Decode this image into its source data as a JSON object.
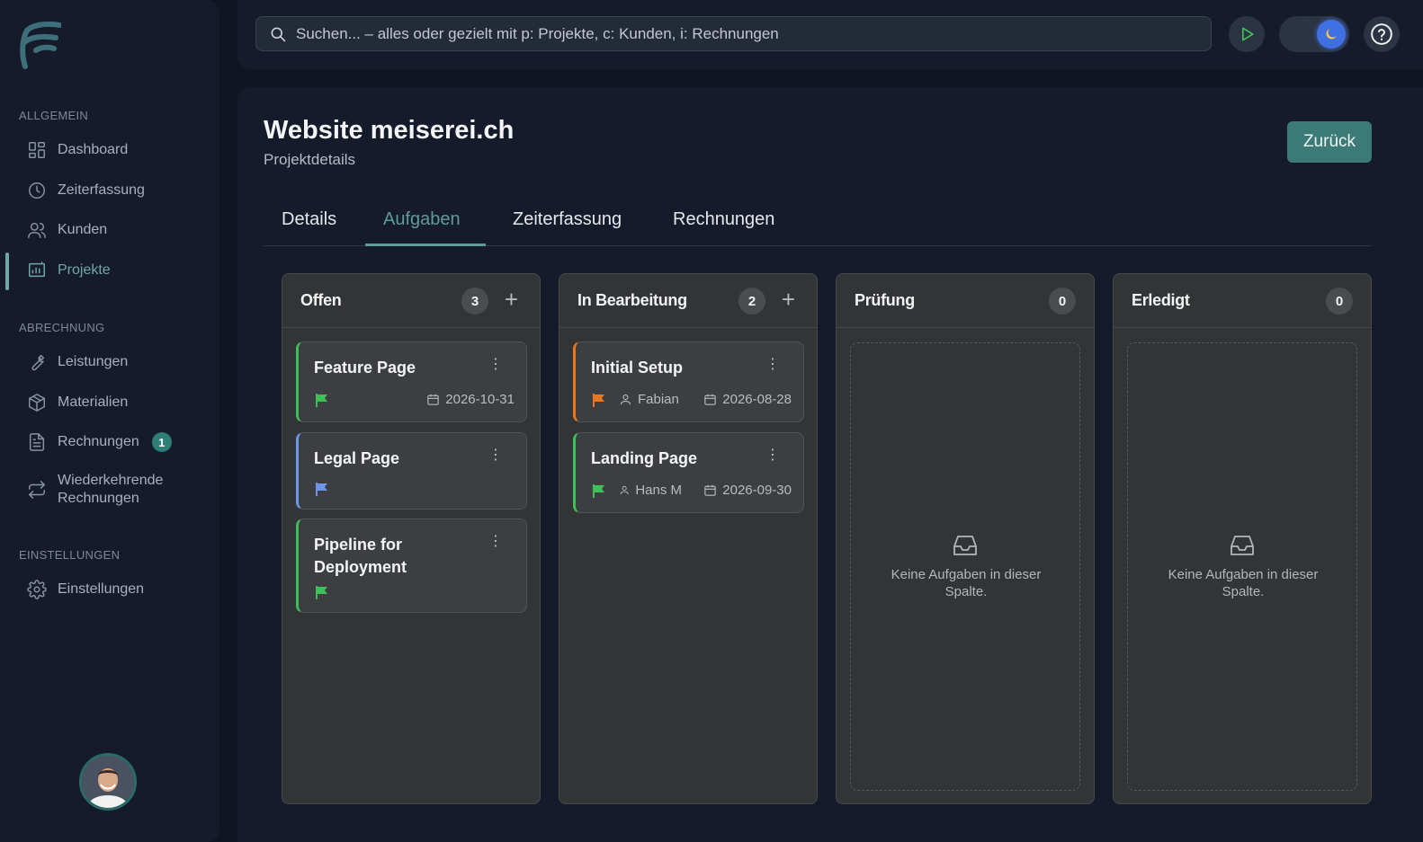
{
  "sidebar": {
    "sections": {
      "general": "ALLGEMEIN",
      "billing": "ABRECHNUNG",
      "settings": "EINSTELLUNGEN"
    },
    "items": {
      "dashboard": "Dashboard",
      "time": "Zeiterfassung",
      "customers": "Kunden",
      "projects": "Projekte",
      "services": "Leistungen",
      "materials": "Materialien",
      "invoices": "Rechnungen",
      "invoices_badge": "1",
      "recurring_1": "Wiederkehrende",
      "recurring_2": "Rechnungen",
      "settings": "Einstellungen"
    }
  },
  "topbar": {
    "search_placeholder": "Suchen... – alles oder gezielt mit p: Projekte, c: Kunden, i: Rechnungen"
  },
  "page": {
    "title": "Website meiserei.ch",
    "subtitle": "Projektdetails",
    "back_label": "Zurück"
  },
  "tabs": [
    "Details",
    "Aufgaben",
    "Zeiterfassung",
    "Rechnungen"
  ],
  "board": {
    "columns": [
      {
        "title": "Offen",
        "count": "3",
        "cards": [
          {
            "title": "Feature Page",
            "date": "2026-10-31",
            "priority_color": "#3fbf5a"
          },
          {
            "title": "Legal Page",
            "priority_color": "#6f95e8"
          },
          {
            "title_1": "Pipeline for",
            "title_2": "Deployment",
            "priority_color": "#3fbf5a"
          }
        ]
      },
      {
        "title": "In Bearbeitung",
        "count": "2",
        "cards": [
          {
            "title": "Initial Setup",
            "assignee": "Fabian",
            "date": "2026-08-28",
            "priority_color": "#e8771e"
          },
          {
            "title": "Landing Page",
            "assignee": "Hans M",
            "date": "2026-09-30",
            "priority_color": "#3fbf5a"
          }
        ]
      },
      {
        "title": "Prüfung",
        "count": "0",
        "empty": "Keine Aufgaben in dieser Spalte."
      },
      {
        "title": "Erledigt",
        "count": "0",
        "empty": "Keine Aufgaben in dieser Spalte."
      }
    ]
  },
  "colors": {
    "accent": "#5f9b98",
    "background": "#0f1521",
    "panel": "#151b2a",
    "column": "#323436"
  }
}
